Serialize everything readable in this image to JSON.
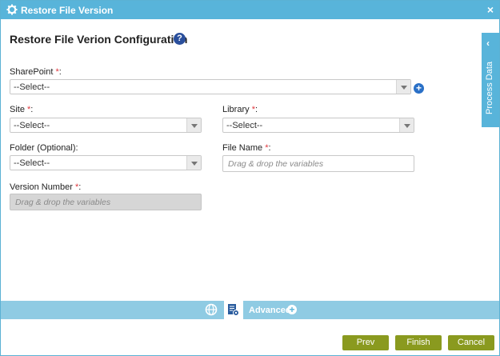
{
  "window": {
    "title": "Restore File Version",
    "close_label": "×"
  },
  "heading": "Restore File Verion Configuration",
  "help_icon": "?",
  "fields": {
    "sharepoint": {
      "label": "SharePoint ",
      "required": "*",
      "colon": ":",
      "value": "--Select--"
    },
    "site": {
      "label": "Site ",
      "required": "*",
      "colon": ":",
      "value": "--Select--"
    },
    "library": {
      "label": "Library ",
      "required": "*",
      "colon": ":",
      "value": "--Select--"
    },
    "folder": {
      "label": "Folder (Optional):",
      "value": "--Select--"
    },
    "file_name": {
      "label": "File Name ",
      "required": "*",
      "colon": ":",
      "placeholder": "Drag & drop the variables"
    },
    "version_number": {
      "label": "Version Number ",
      "required": "*",
      "colon": ":",
      "placeholder": "Drag & drop the variables"
    }
  },
  "add_icon": "+",
  "process_data": {
    "chevron": "‹",
    "label": "Process Data"
  },
  "bottom_bar": {
    "advanced_label": "Advanced",
    "advanced_plus": "+"
  },
  "buttons": {
    "prev": "Prev",
    "finish": "Finish",
    "cancel": "Cancel"
  },
  "colors": {
    "accent": "#58b4da",
    "button": "#8a9a1f",
    "required": "#e0383e",
    "help": "#2a4f9c"
  }
}
